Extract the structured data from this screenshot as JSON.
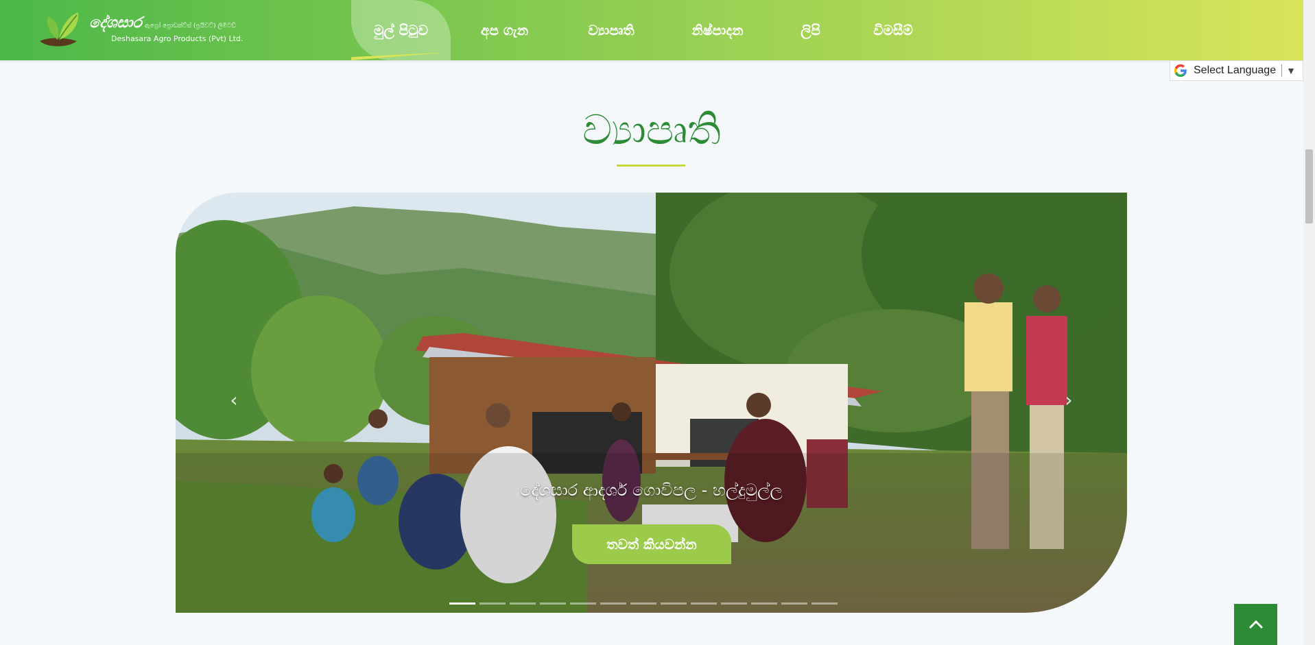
{
  "header": {
    "logo": {
      "name": "දේශසාර",
      "name_small": "ඇග්‍රෝ ප්‍රොඩක්ට්ස් (ප්‍රයිවට්) ලිමිටඩ්",
      "subtitle": "Deshasara Agro Products (Pvt) Ltd."
    },
    "nav": [
      {
        "label": "මුල් පිටුව",
        "active": true
      },
      {
        "label": "අප ගැන",
        "active": false
      },
      {
        "label": "ව්‍යාපෘති",
        "active": false
      },
      {
        "label": "නිෂ්පාදන",
        "active": false
      },
      {
        "label": "ලිපි",
        "active": false
      },
      {
        "label": "විමසීම්",
        "active": false
      }
    ]
  },
  "translate": {
    "label": "Select Language",
    "icon": "google-g-icon"
  },
  "section": {
    "title": "ව්‍යාපෘති"
  },
  "carousel": {
    "caption": "දේශසාර ආදර්ශ ගොවිපල - හල්දුමුල්ල",
    "button_label": "තවත් කියවන්න",
    "slide_count": 13,
    "active_index": 0,
    "prev_icon": "chevron-left-icon",
    "next_icon": "chevron-right-icon"
  },
  "colors": {
    "brand_green": "#2e8b35",
    "header_start": "#4cb848",
    "header_end": "#d8e45a",
    "button_green": "#9ccb4c",
    "accent_yellow": "#c4d83a"
  }
}
